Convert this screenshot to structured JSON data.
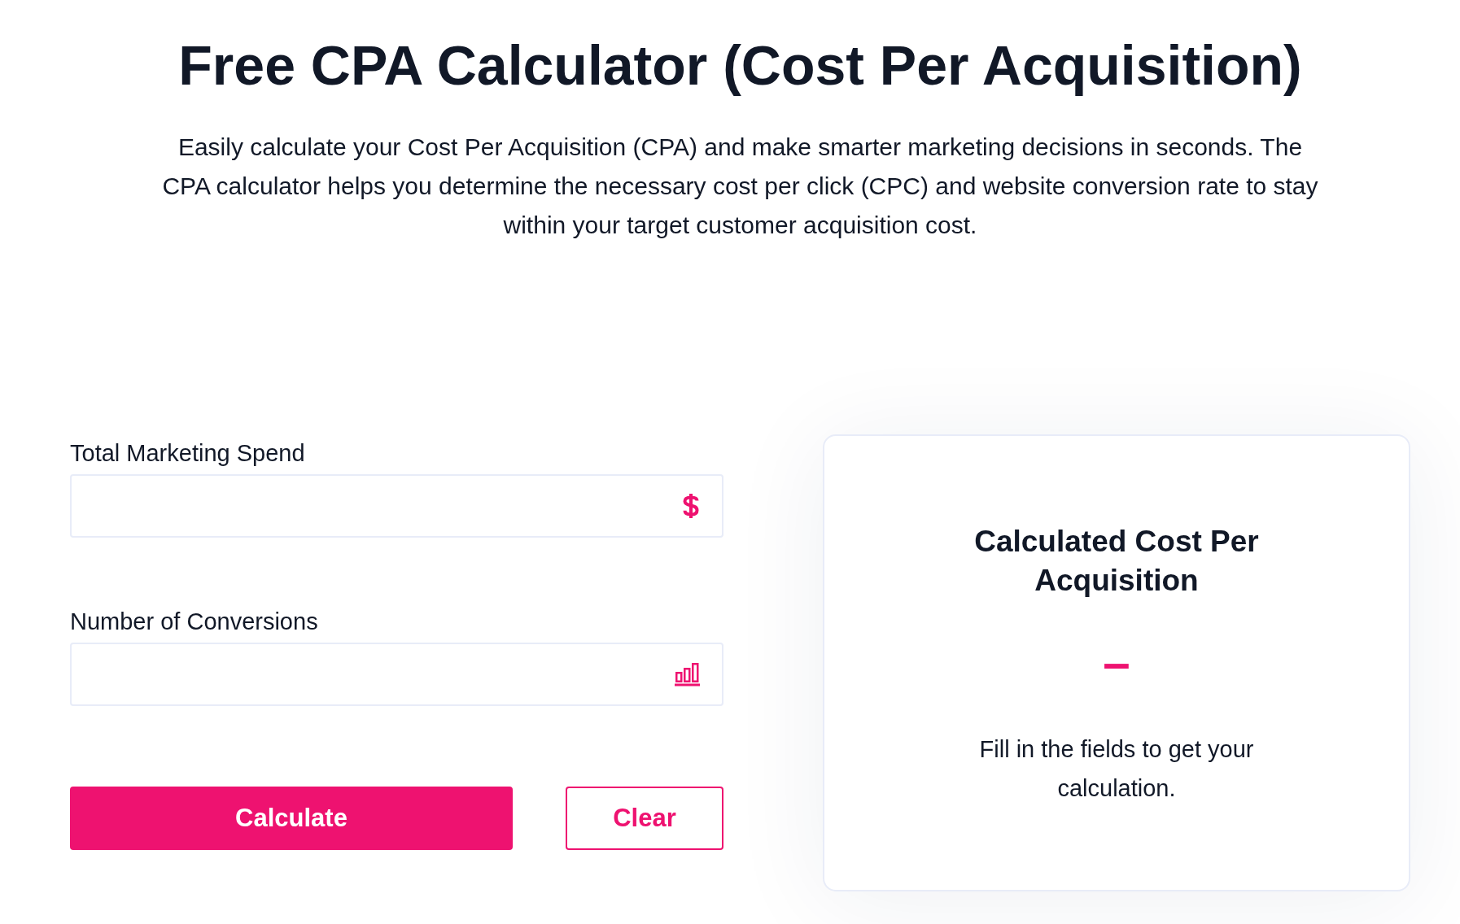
{
  "title": "Free CPA Calculator (Cost Per Acquisition)",
  "description": "Easily calculate your Cost Per Acquisition (CPA) and make smarter marketing decisions in seconds. The CPA calculator helps you determine the necessary cost per click (CPC) and website conversion rate to stay within your target customer acquisition cost.",
  "form": {
    "fields": [
      {
        "label": "Total Marketing Spend",
        "kind": "currency"
      },
      {
        "label": "Number of Conversions",
        "kind": "count"
      }
    ],
    "buttons": [
      {
        "label": "Calculate",
        "kind": "primary"
      },
      {
        "label": "Clear",
        "kind": "outline"
      }
    ]
  },
  "result": {
    "title": "Calculated Cost Per Acquisition",
    "value": "–",
    "hint": "Fill in the fields to get your calculation."
  }
}
